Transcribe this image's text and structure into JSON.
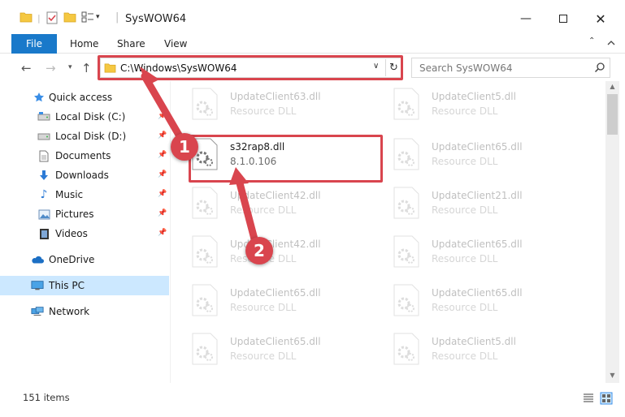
{
  "window": {
    "title": "SysWOW64",
    "min_icon": "minimize-icon",
    "max_icon": "maximize-icon",
    "close_icon": "close-icon"
  },
  "ribbon": {
    "tabs": [
      {
        "label": "File"
      },
      {
        "label": "Home"
      },
      {
        "label": "Share"
      },
      {
        "label": "View"
      }
    ]
  },
  "address": {
    "path": "C:\\Windows\\SysWOW64",
    "search_placeholder": "Search SysWOW64"
  },
  "sidebar": {
    "items": [
      {
        "label": "Quick access",
        "icon": "star-icon"
      },
      {
        "label": "Local Disk (C:)",
        "icon": "drive-icon",
        "pinned": true
      },
      {
        "label": "Local Disk (D:)",
        "icon": "drive-icon",
        "pinned": true
      },
      {
        "label": "Documents",
        "icon": "documents-icon",
        "pinned": true
      },
      {
        "label": "Downloads",
        "icon": "downloads-icon",
        "pinned": true
      },
      {
        "label": "Music",
        "icon": "music-icon",
        "pinned": true
      },
      {
        "label": "Pictures",
        "icon": "pictures-icon",
        "pinned": true
      },
      {
        "label": "Videos",
        "icon": "videos-icon",
        "pinned": true
      },
      {
        "label": "OneDrive",
        "icon": "cloud-icon"
      },
      {
        "label": "This PC",
        "icon": "computer-icon",
        "selected": true
      },
      {
        "label": "Network",
        "icon": "network-icon"
      }
    ]
  },
  "files": [
    {
      "name": "UpdateClient63.dll",
      "desc": "Resource DLL",
      "faded": true
    },
    {
      "name": "UpdateClient5.dll",
      "desc": "Resource DLL",
      "faded": true
    },
    {
      "name": "s32rap8.dll",
      "desc": "8.1.0.106",
      "faded": false
    },
    {
      "name": "UpdateClient65.dll",
      "desc": "Resource DLL",
      "faded": true
    },
    {
      "name": "UpdateClient42.dll",
      "desc": "Resource DLL",
      "faded": true
    },
    {
      "name": "UpdateClient21.dll",
      "desc": "Resource DLL",
      "faded": true
    },
    {
      "name": "UpdateClient42.dll",
      "desc": "Resource DLL",
      "faded": true
    },
    {
      "name": "UpdateClient65.dll",
      "desc": "Resource DLL",
      "faded": true
    },
    {
      "name": "UpdateClient65.dll",
      "desc": "Resource DLL",
      "faded": true
    },
    {
      "name": "UpdateClient65.dll",
      "desc": "Resource DLL",
      "faded": true
    },
    {
      "name": "UpdateClient65.dll",
      "desc": "Resource DLL",
      "faded": true
    },
    {
      "name": "UpdateClient5.dll",
      "desc": "Resource DLL",
      "faded": true
    }
  ],
  "annotations": {
    "badge1": "1",
    "badge2": "2",
    "highlight_color": "#d9454e"
  },
  "status": {
    "item_count": "151 items"
  },
  "colors": {
    "accent": "#1979ca",
    "selected_bg": "#cce8ff"
  }
}
